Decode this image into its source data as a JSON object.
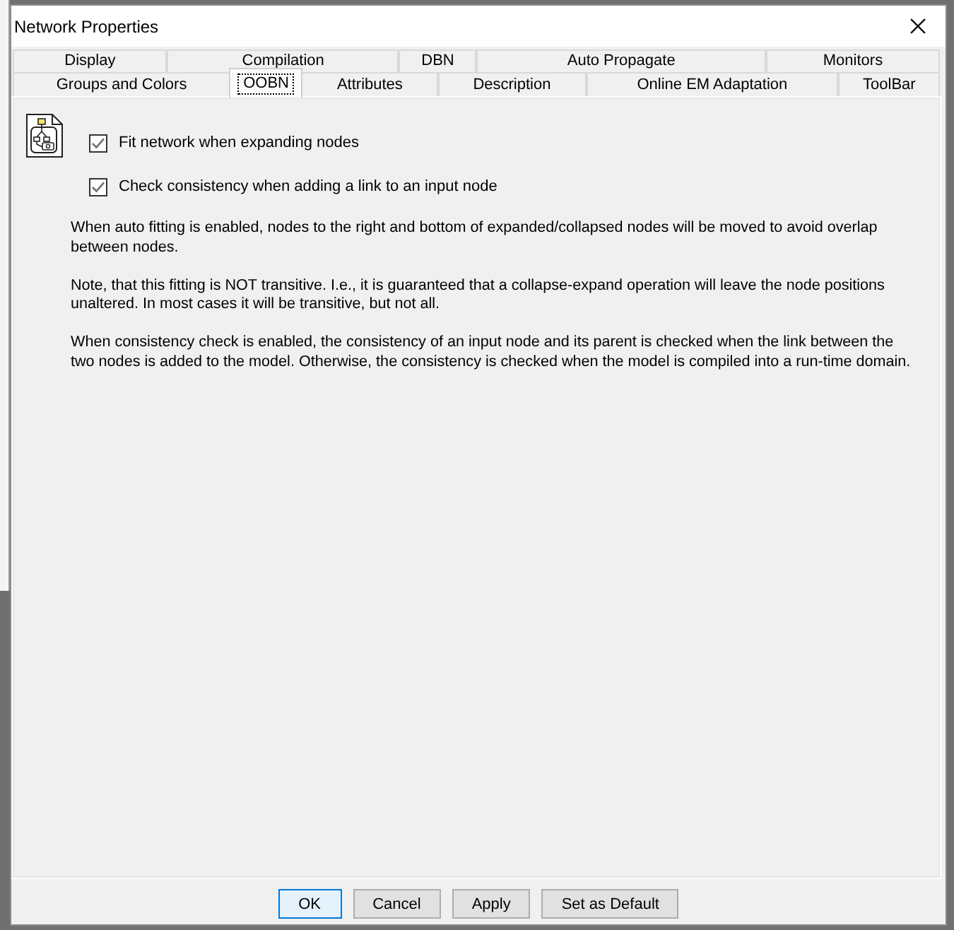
{
  "window": {
    "title": "Network Properties"
  },
  "tab_rows": [
    [
      {
        "label": "Display",
        "selected": false
      },
      {
        "label": "Compilation",
        "selected": false
      },
      {
        "label": "DBN",
        "selected": false
      },
      {
        "label": "Auto Propagate",
        "selected": false
      },
      {
        "label": "Monitors",
        "selected": false
      }
    ],
    [
      {
        "label": "Groups and Colors",
        "selected": false
      },
      {
        "label": "OOBN",
        "selected": true
      },
      {
        "label": "Attributes",
        "selected": false
      },
      {
        "label": "Description",
        "selected": false
      },
      {
        "label": "Online EM Adaptation",
        "selected": false
      },
      {
        "label": "ToolBar",
        "selected": false
      }
    ]
  ],
  "oobn_page": {
    "options": [
      {
        "label": "Fit network when expanding nodes",
        "checked": true
      },
      {
        "label": "Check consistency when adding a link to an input node",
        "checked": true
      }
    ],
    "paragraphs": [
      "When auto fitting is enabled, nodes to the right and bottom of expanded/collapsed nodes will be moved to avoid overlap between nodes.",
      "Note, that this fitting is NOT transitive. I.e., it is guaranteed that a collapse-expand operation will leave the node positions unaltered. In most cases it will be transitive, but not all.",
      "When consistency check is enabled, the consistency of an input node and its parent is checked when the link between the two nodes is added to the model. Otherwise, the consistency is checked when the model is compiled into a run-time domain."
    ]
  },
  "buttons": [
    {
      "label": "OK",
      "default": true
    },
    {
      "label": "Cancel",
      "default": false
    },
    {
      "label": "Apply",
      "default": false
    },
    {
      "label": "Set as Default",
      "default": false
    }
  ]
}
